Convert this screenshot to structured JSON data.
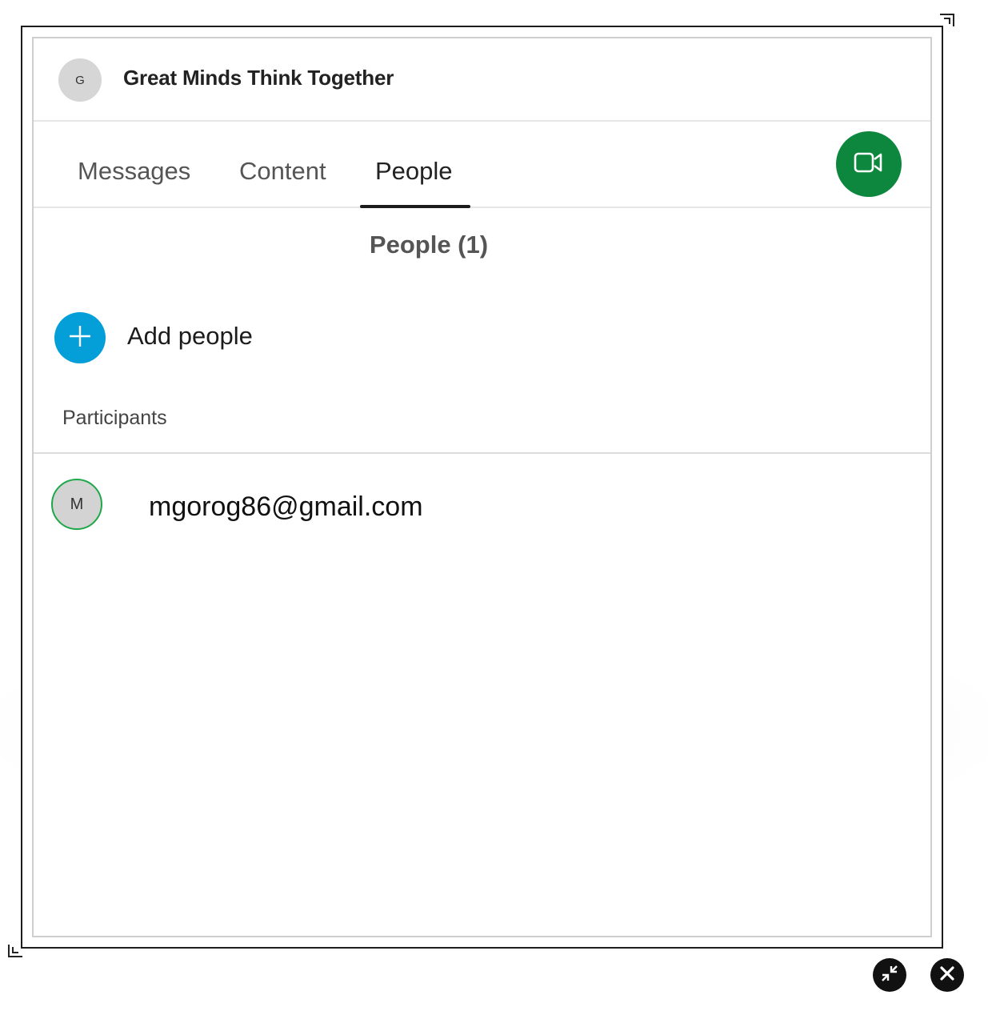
{
  "space": {
    "avatar_initial": "G",
    "title": "Great Minds Think Together"
  },
  "tabs": [
    {
      "label": "Messages",
      "active": false
    },
    {
      "label": "Content",
      "active": false
    },
    {
      "label": "People",
      "active": true
    }
  ],
  "call_button": {
    "icon": "video-camera-icon",
    "color": "#0d873e"
  },
  "people": {
    "heading": "People (1)",
    "add_label": "Add people",
    "add_icon": "plus-icon",
    "add_color": "#049fd9",
    "section_label": "Participants",
    "participants": [
      {
        "initial": "M",
        "name": "mgorog86@gmail.com",
        "status_color": "#1ea84a"
      }
    ]
  },
  "window_controls": {
    "minimize_icon": "collapse-arrows-icon",
    "close_icon": "close-icon"
  }
}
